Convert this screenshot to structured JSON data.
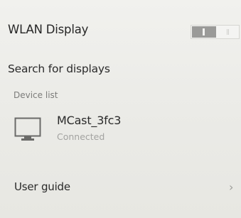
{
  "wlan": {
    "title": "WLAN Display",
    "toggle_on": true
  },
  "search": {
    "label": "Search for displays"
  },
  "device_list": {
    "header": "Device list",
    "devices": [
      {
        "name": "MCast_3fc3",
        "status": "Connected",
        "icon": "monitor-icon"
      }
    ]
  },
  "user_guide": {
    "label": "User guide",
    "icon": "chevron-right-icon",
    "chevron": "›"
  }
}
